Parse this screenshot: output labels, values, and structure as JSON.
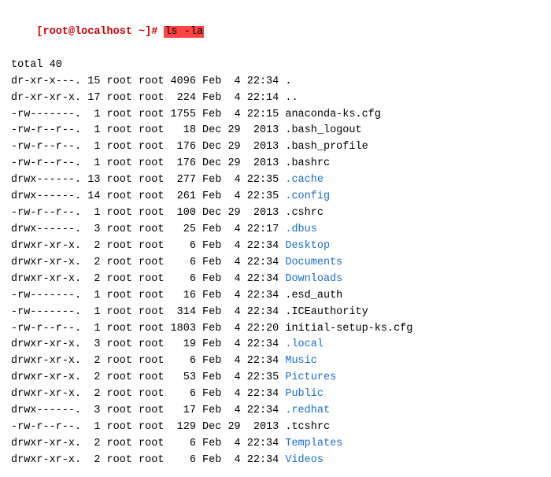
{
  "terminal": {
    "prompt": "[root@localhost ~]# ",
    "command": "ls -la",
    "total_line": "total 40",
    "entries": [
      {
        "perms": "dr-xr-x---.",
        "links": "15",
        "user": "root",
        "group": "root",
        "size": "4096",
        "month": "Feb",
        "day": " 4",
        "time": "22:34",
        "name": ".",
        "color": "plain"
      },
      {
        "perms": "dr-xr-xr-x.",
        "links": "17",
        "user": "root",
        "group": "root",
        "size": " 224",
        "month": "Feb",
        "day": " 4",
        "time": "22:14",
        "name": "..",
        "color": "plain"
      },
      {
        "perms": "-rw-------.",
        "links": " 1",
        "user": "root",
        "group": "root",
        "size": "1755",
        "month": "Feb",
        "day": " 4",
        "time": "22:15",
        "name": "anaconda-ks.cfg",
        "color": "plain"
      },
      {
        "perms": "-rw-r--r--.",
        "links": " 1",
        "user": "root",
        "group": "root",
        "size": "  18",
        "month": "Dec",
        "day": "29",
        "time": " 2013",
        "name": ".bash_logout",
        "color": "plain"
      },
      {
        "perms": "-rw-r--r--.",
        "links": " 1",
        "user": "root",
        "group": "root",
        "size": " 176",
        "month": "Dec",
        "day": "29",
        "time": " 2013",
        "name": ".bash_profile",
        "color": "plain"
      },
      {
        "perms": "-rw-r--r--.",
        "links": " 1",
        "user": "root",
        "group": "root",
        "size": " 176",
        "month": "Dec",
        "day": "29",
        "time": " 2013",
        "name": ".bashrc",
        "color": "plain"
      },
      {
        "perms": "drwx------.",
        "links": "13",
        "user": "root",
        "group": "root",
        "size": " 277",
        "month": "Feb",
        "day": " 4",
        "time": "22:35",
        "name": ".cache",
        "color": "blue"
      },
      {
        "perms": "drwx------.",
        "links": "14",
        "user": "root",
        "group": "root",
        "size": " 261",
        "month": "Feb",
        "day": " 4",
        "time": "22:35",
        "name": ".config",
        "color": "blue"
      },
      {
        "perms": "-rw-r--r--.",
        "links": " 1",
        "user": "root",
        "group": "root",
        "size": " 100",
        "month": "Dec",
        "day": "29",
        "time": " 2013",
        "name": ".cshrc",
        "color": "plain"
      },
      {
        "perms": "drwx------.",
        "links": " 3",
        "user": "root",
        "group": "root",
        "size": "  25",
        "month": "Feb",
        "day": " 4",
        "time": "22:17",
        "name": ".dbus",
        "color": "blue"
      },
      {
        "perms": "drwxr-xr-x.",
        "links": " 2",
        "user": "root",
        "group": "root",
        "size": "   6",
        "month": "Feb",
        "day": " 4",
        "time": "22:34",
        "name": "Desktop",
        "color": "blue"
      },
      {
        "perms": "drwxr-xr-x.",
        "links": " 2",
        "user": "root",
        "group": "root",
        "size": "   6",
        "month": "Feb",
        "day": " 4",
        "time": "22:34",
        "name": "Documents",
        "color": "blue"
      },
      {
        "perms": "drwxr-xr-x.",
        "links": " 2",
        "user": "root",
        "group": "root",
        "size": "   6",
        "month": "Feb",
        "day": " 4",
        "time": "22:34",
        "name": "Downloads",
        "color": "blue"
      },
      {
        "perms": "-rw-------.",
        "links": " 1",
        "user": "root",
        "group": "root",
        "size": "  16",
        "month": "Feb",
        "day": " 4",
        "time": "22:34",
        "name": ".esd_auth",
        "color": "plain"
      },
      {
        "perms": "-rw-------.",
        "links": " 1",
        "user": "root",
        "group": "root",
        "size": " 314",
        "month": "Feb",
        "day": " 4",
        "time": "22:34",
        "name": ".ICEauthority",
        "color": "plain"
      },
      {
        "perms": "-rw-r--r--.",
        "links": " 1",
        "user": "root",
        "group": "root",
        "size": "1803",
        "month": "Feb",
        "day": " 4",
        "time": "22:20",
        "name": "initial-setup-ks.cfg",
        "color": "plain"
      },
      {
        "perms": "drwxr-xr-x.",
        "links": " 3",
        "user": "root",
        "group": "root",
        "size": "  19",
        "month": "Feb",
        "day": " 4",
        "time": "22:34",
        "name": ".local",
        "color": "blue"
      },
      {
        "perms": "drwxr-xr-x.",
        "links": " 2",
        "user": "root",
        "group": "root",
        "size": "   6",
        "month": "Feb",
        "day": " 4",
        "time": "22:34",
        "name": "Music",
        "color": "blue"
      },
      {
        "perms": "drwxr-xr-x.",
        "links": " 2",
        "user": "root",
        "group": "root",
        "size": "  53",
        "month": "Feb",
        "day": " 4",
        "time": "22:35",
        "name": "Pictures",
        "color": "blue"
      },
      {
        "perms": "drwxr-xr-x.",
        "links": " 2",
        "user": "root",
        "group": "root",
        "size": "   6",
        "month": "Feb",
        "day": " 4",
        "time": "22:34",
        "name": "Public",
        "color": "blue"
      },
      {
        "perms": "drwx------.",
        "links": " 3",
        "user": "root",
        "group": "root",
        "size": "  17",
        "month": "Feb",
        "day": " 4",
        "time": "22:34",
        "name": ".redhat",
        "color": "blue"
      },
      {
        "perms": "-rw-r--r--.",
        "links": " 1",
        "user": "root",
        "group": "root",
        "size": " 129",
        "month": "Dec",
        "day": "29",
        "time": " 2013",
        "name": ".tcshrc",
        "color": "plain"
      },
      {
        "perms": "drwxr-xr-x.",
        "links": " 2",
        "user": "root",
        "group": "root",
        "size": "   6",
        "month": "Feb",
        "day": " 4",
        "time": "22:34",
        "name": "Templates",
        "color": "blue"
      },
      {
        "perms": "drwxr-xr-x.",
        "links": " 2",
        "user": "root",
        "group": "root",
        "size": "   6",
        "month": "Feb",
        "day": " 4",
        "time": "22:34",
        "name": "Videos",
        "color": "blue"
      }
    ]
  }
}
